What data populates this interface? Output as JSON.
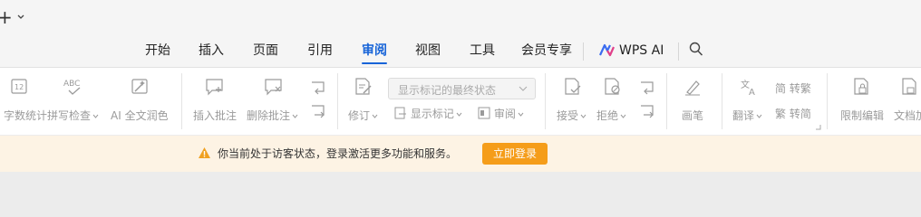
{
  "topbar": {
    "plus_label": "+"
  },
  "tabs": [
    {
      "label": "开始"
    },
    {
      "label": "插入"
    },
    {
      "label": "页面"
    },
    {
      "label": "引用"
    },
    {
      "label": "审阅",
      "active": true
    },
    {
      "label": "视图"
    },
    {
      "label": "工具"
    },
    {
      "label": "会员专享"
    },
    {
      "label": "WPS AI"
    }
  ],
  "toolbar": {
    "word_count": "字数统计",
    "spell_check": "拼写检查",
    "ai_polish": "AI 全文润色",
    "insert_comment": "插入批注",
    "delete_comment": "删除批注",
    "revise": "修订",
    "markup_dropdown": "显示标记的最终状态",
    "show_markup": "显示标记",
    "review": "审阅",
    "accept": "接受",
    "reject": "拒绝",
    "pen": "画笔",
    "translate": "翻译",
    "simplified_to_traditional": "简 转繁",
    "traditional_to_simplified": "繁 转简",
    "restrict_edit": "限制编辑",
    "doc_protect": "文档加"
  },
  "notice": {
    "message": "你当前处于访客状态，登录激活更多功能和服务。",
    "login_label": "立即登录"
  },
  "colors": {
    "accent": "#1764d8",
    "login_button": "#f59d1a",
    "notice_bg": "#fdf3e4",
    "warning": "#f0a020"
  }
}
